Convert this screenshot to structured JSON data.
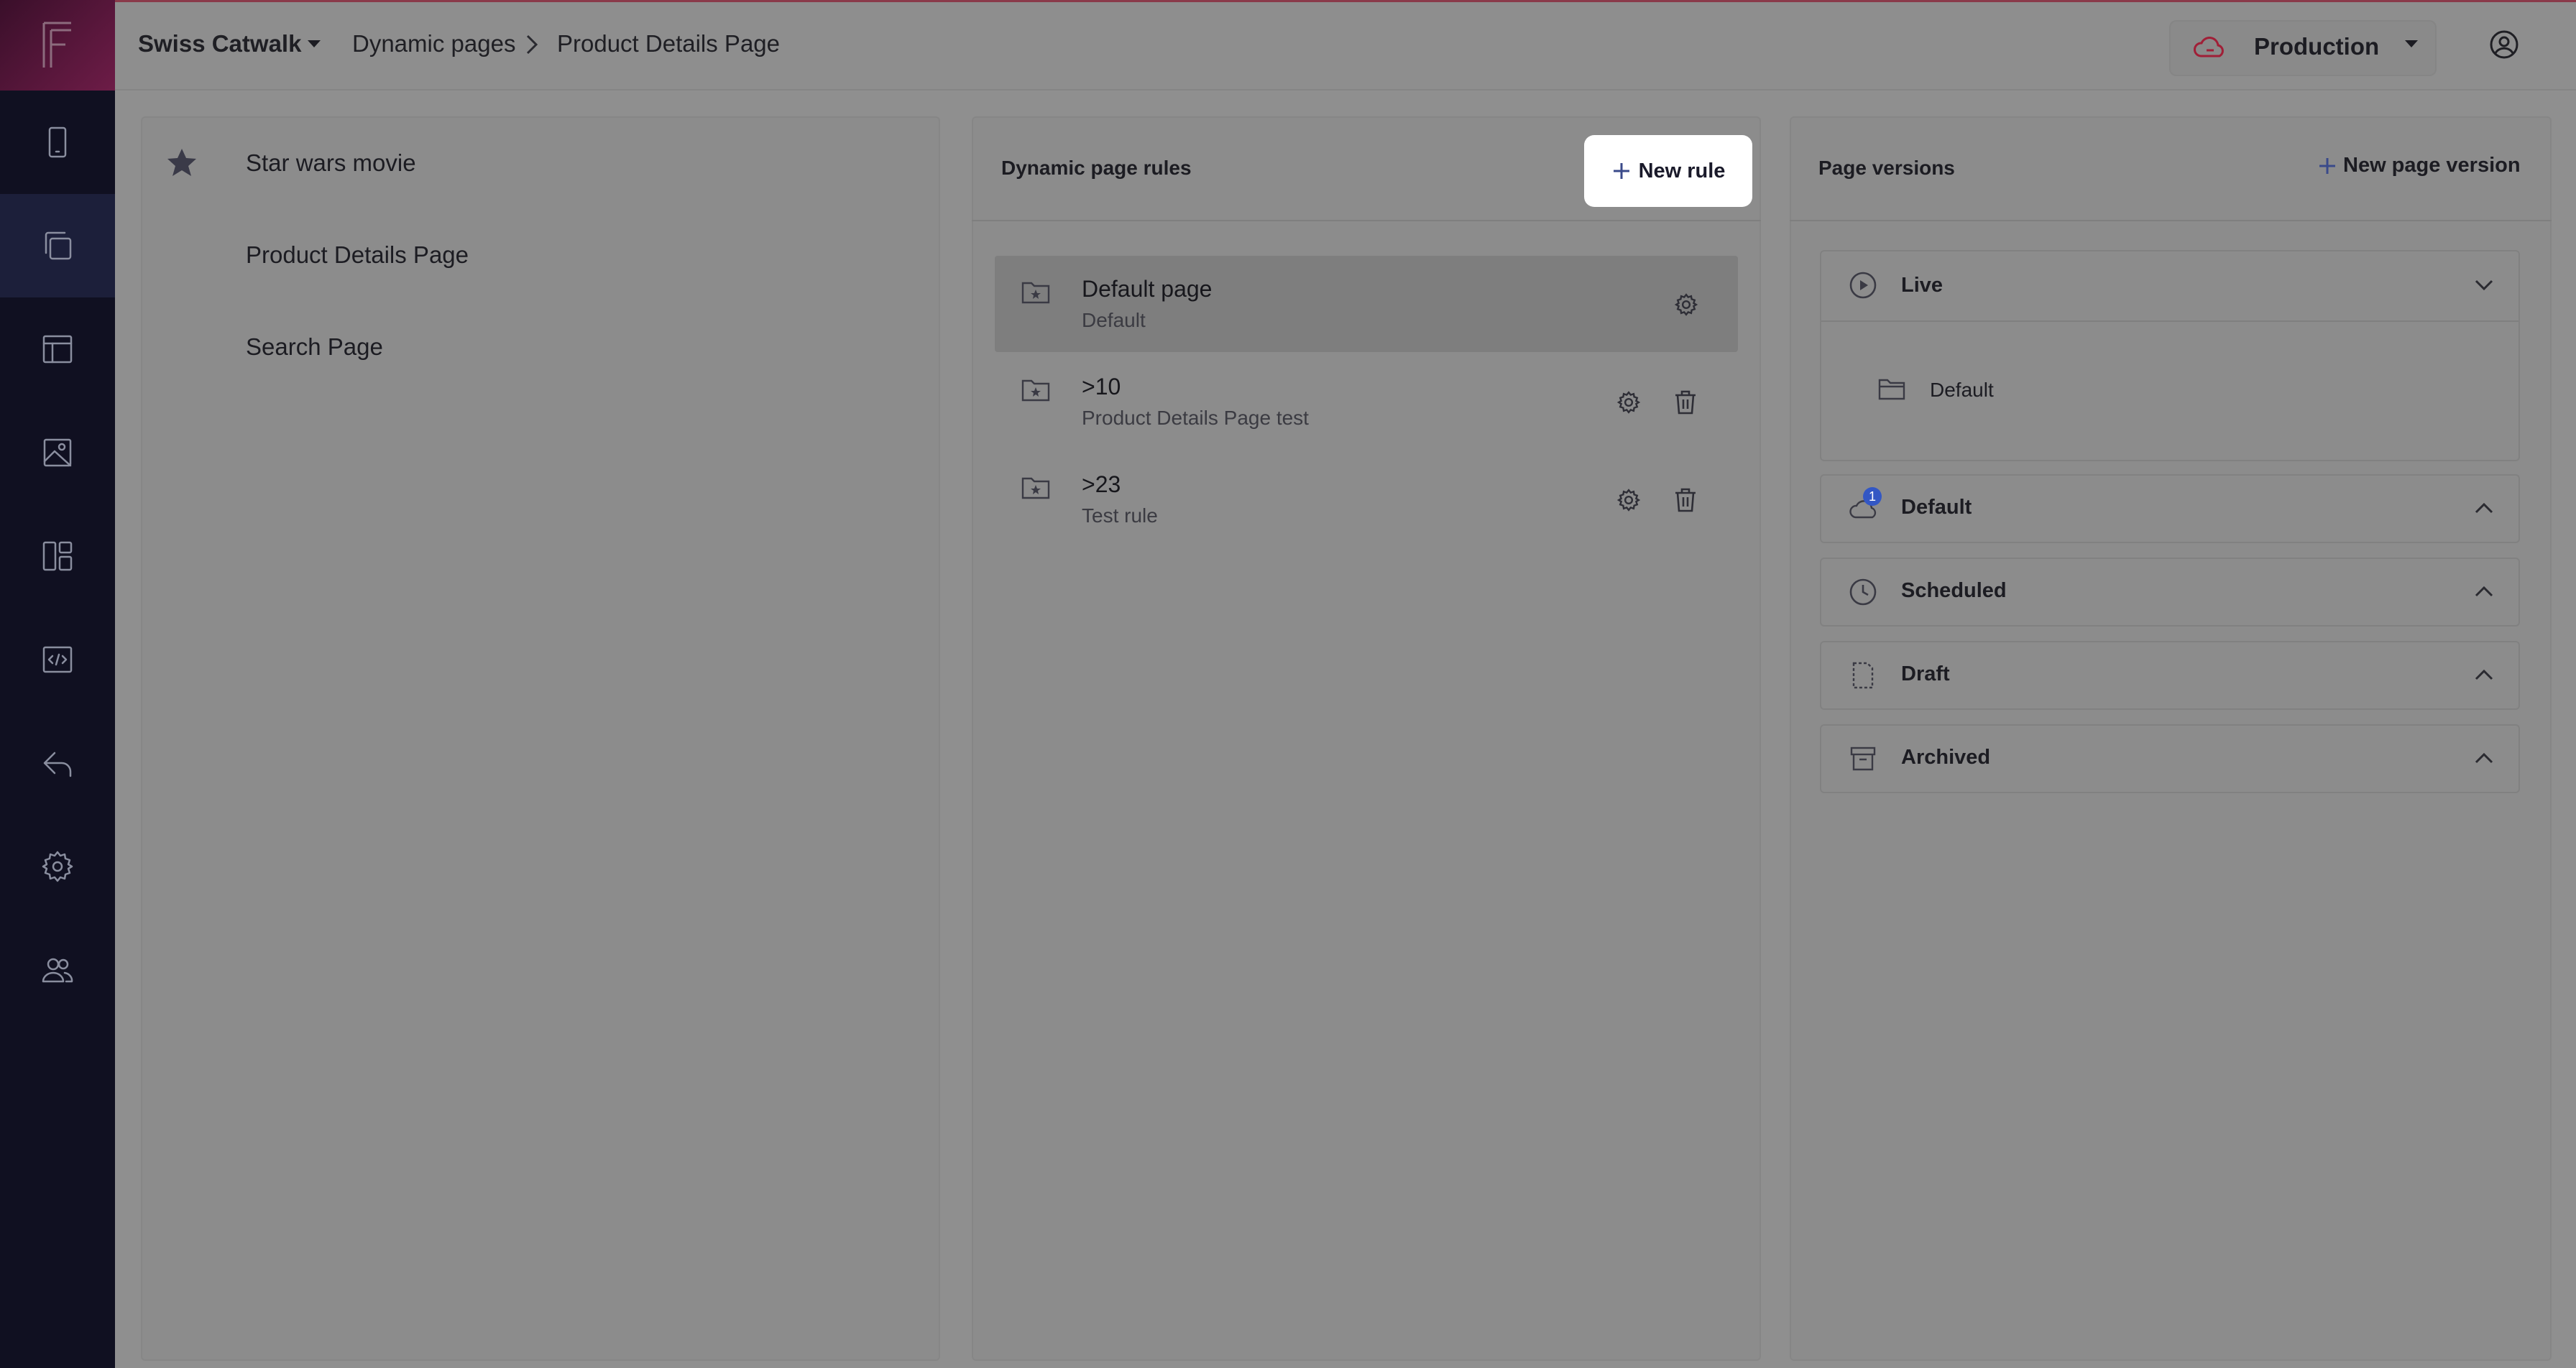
{
  "topbar": {
    "project": "Swiss Catwalk",
    "crumb1": "Dynamic pages",
    "crumb2": "Product Details Page",
    "environment": "Production"
  },
  "pages": {
    "items": [
      {
        "label": "Star wars movie"
      },
      {
        "label": "Product Details Page"
      },
      {
        "label": "Search Page"
      }
    ]
  },
  "rules": {
    "title": "Dynamic page rules",
    "new_label": "New rule",
    "items": [
      {
        "title": "Default page",
        "subtitle": "Default"
      },
      {
        "title": ">10",
        "subtitle": "Product Details Page test"
      },
      {
        "title": ">23",
        "subtitle": "Test rule"
      }
    ]
  },
  "versions": {
    "title": "Page versions",
    "new_label": "New page version",
    "live": {
      "label": "Live",
      "item": "Default"
    },
    "default": {
      "label": "Default",
      "badge": "1"
    },
    "scheduled": {
      "label": "Scheduled"
    },
    "draft": {
      "label": "Draft"
    },
    "archived": {
      "label": "Archived"
    }
  },
  "colors": {
    "sidebar": "#101021",
    "overlay": "#8f8f8f",
    "brand": "#6d1c47",
    "badge": "#3357c4"
  }
}
